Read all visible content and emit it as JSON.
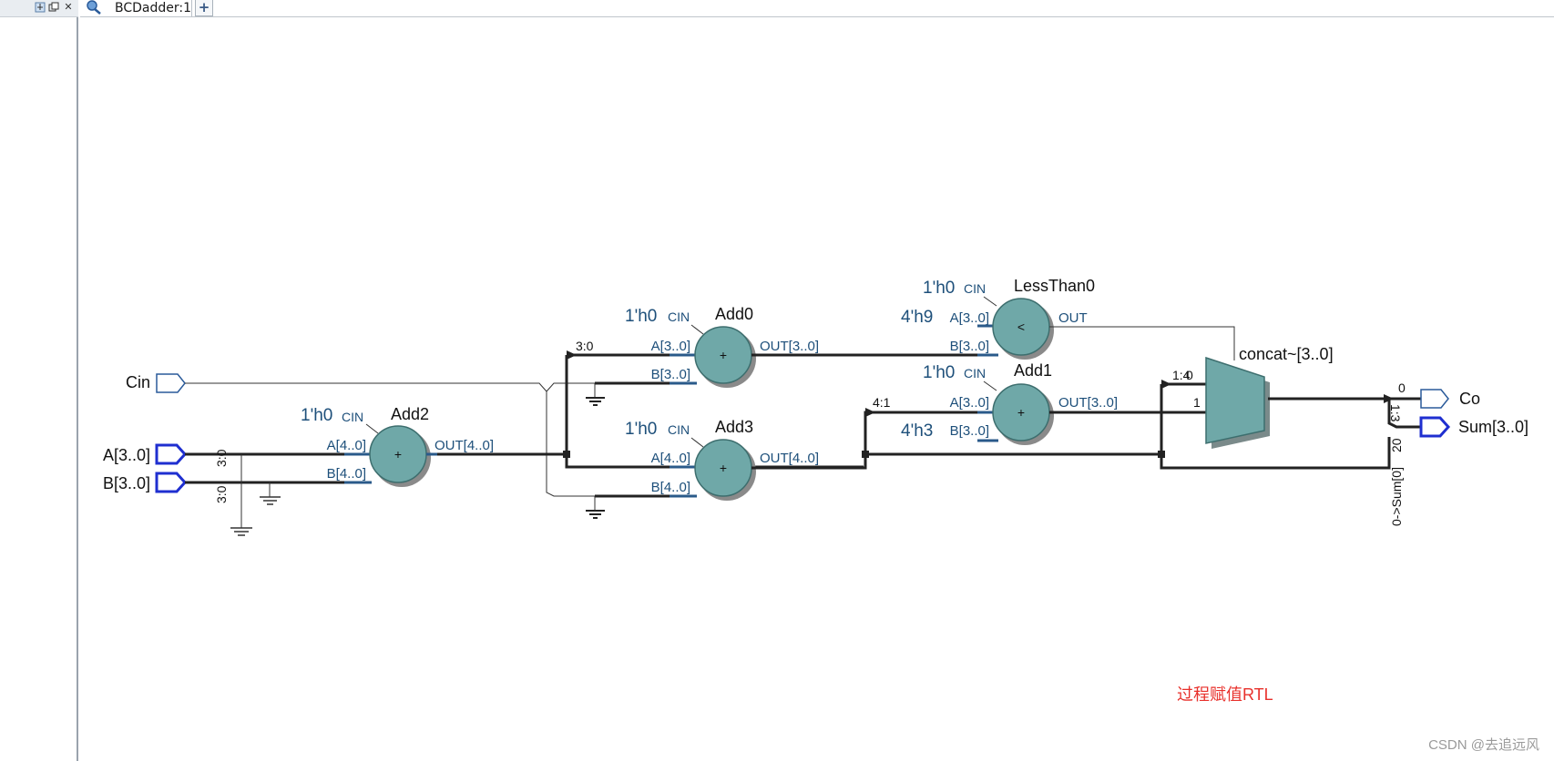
{
  "left_panel": {
    "pin_icon": "pin-icon",
    "float_icon": "float-window-icon",
    "close_icon": "close-icon"
  },
  "tabs": {
    "active_label": "BCDadder:1",
    "add_label": "+",
    "tab_icon": "rtl-viewer-icon"
  },
  "schematic": {
    "inputs": [
      "Cin",
      "A[3..0]",
      "B[3..0]"
    ],
    "outputs": [
      "Co",
      "Sum[3..0]"
    ],
    "add2": {
      "name": "Add2",
      "cin": "CIN",
      "cin_const": "1'h0",
      "a": "A[4..0]",
      "b": "B[4..0]",
      "out": "OUT[4..0]",
      "op": "+"
    },
    "add0": {
      "name": "Add0",
      "cin": "CIN",
      "cin_const": "1'h0",
      "a": "A[3..0]",
      "b": "B[3..0]",
      "out": "OUT[3..0]",
      "op": "+"
    },
    "add3": {
      "name": "Add3",
      "cin": "CIN",
      "cin_const": "1'h0",
      "a": "A[4..0]",
      "b": "B[4..0]",
      "out": "OUT[4..0]",
      "op": "+"
    },
    "lessthan0": {
      "name": "LessThan0",
      "cin": "CIN",
      "cin_const": "1'h0",
      "a_const": "4'h9",
      "a": "A[3..0]",
      "b": "B[3..0]",
      "out": "OUT",
      "op": "<"
    },
    "add1": {
      "name": "Add1",
      "cin": "CIN",
      "cin_const": "1'h0",
      "b_const": "4'h3",
      "a": "A[3..0]",
      "b": "B[3..0]",
      "out": "OUT[3..0]",
      "op": "+"
    },
    "concat": {
      "name": "concat~[3..0]",
      "in0": "1:4",
      "in0_sel": "0",
      "in1": "1"
    },
    "bus_labels": {
      "a_split": "3:0",
      "b_split": "3:0",
      "add0_in": "3:0",
      "add1_in": "4:1",
      "out_tap": "0",
      "out_range": "1:3",
      "sum_tap": "0->Sum[0]",
      "sum_tap2": "20"
    },
    "annotation": "过程赋值RTL"
  },
  "watermark": "CSDN @去追远风"
}
